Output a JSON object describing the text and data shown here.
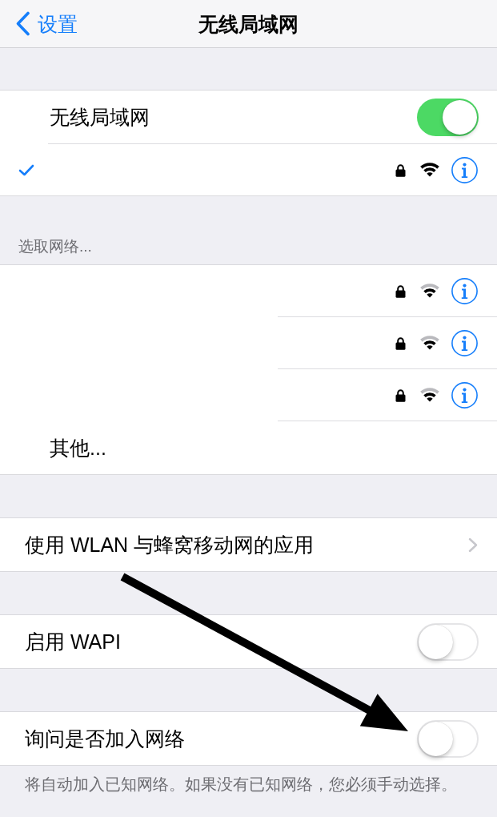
{
  "nav_bar": {
    "back": "设置",
    "title": "无线局域网"
  },
  "wifi_section": {
    "rows": [
      {
        "kind": "switch",
        "label": "无线局域网",
        "on": true
      },
      {
        "kind": "network",
        "checked": true,
        "locked": true,
        "signal_full": true
      }
    ]
  },
  "choose_network": {
    "header": "选取网络...",
    "rows": [
      {
        "kind": "network",
        "checked": false,
        "locked": true,
        "signal_full": false
      },
      {
        "kind": "network",
        "checked": false,
        "locked": true,
        "signal_full": false
      },
      {
        "kind": "network",
        "checked": false,
        "locked": true,
        "signal_full": false
      },
      {
        "kind": "item",
        "label": "其他..."
      }
    ]
  },
  "settings_sections": [
    {
      "rows": [
        {
          "kind": "link",
          "label": "使用 WLAN 与蜂窝移动网的应用"
        }
      ]
    },
    {
      "rows": [
        {
          "kind": "switch",
          "label": "启用 WAPI",
          "on": false
        }
      ]
    },
    {
      "rows": [
        {
          "kind": "switch",
          "label": "询问是否加入网络",
          "on": false
        }
      ],
      "footer": "将自动加入已知网络。如果没有已知网络，您必须手动选择。"
    }
  ],
  "annotations": [
    {
      "kind": "arrow"
    }
  ]
}
